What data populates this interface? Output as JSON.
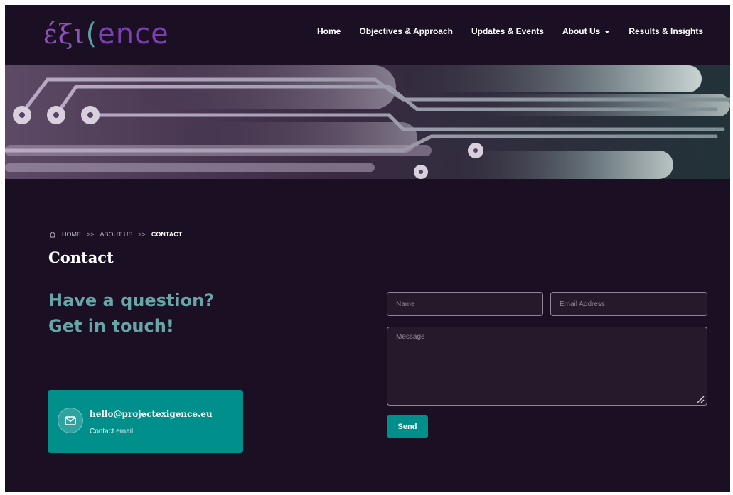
{
  "brand": {
    "logo_greek": "έξι",
    "logo_bracket": "(",
    "logo_rest": "ence"
  },
  "nav": {
    "items": [
      {
        "label": "Home"
      },
      {
        "label": "Objectives & Approach"
      },
      {
        "label": "Updates & Events"
      },
      {
        "label": "About Us",
        "dropdown": true
      },
      {
        "label": "Results & Insights"
      }
    ]
  },
  "breadcrumb": {
    "home": "HOME",
    "separator": ">>",
    "parent": "ABOUT US",
    "current": "CONTACT"
  },
  "page": {
    "title": "Contact",
    "headline_line1": "Have a question?",
    "headline_line2": "Get in touch!"
  },
  "contact": {
    "email": "hello@projectexigence.eu",
    "sublabel": "Contact email"
  },
  "form": {
    "name_placeholder": "Name",
    "email_placeholder": "Email Address",
    "message_placeholder": "Message",
    "send_label": "Send"
  },
  "colors": {
    "background": "#1b0f24",
    "accent": "#008f8a",
    "headline": "#68a5a8",
    "logo_purple": "#7b3fb0"
  },
  "icons": {
    "home": "home-icon",
    "mail": "mail-icon",
    "caret": "caret-down-icon",
    "resize": "resize-grip-icon"
  }
}
